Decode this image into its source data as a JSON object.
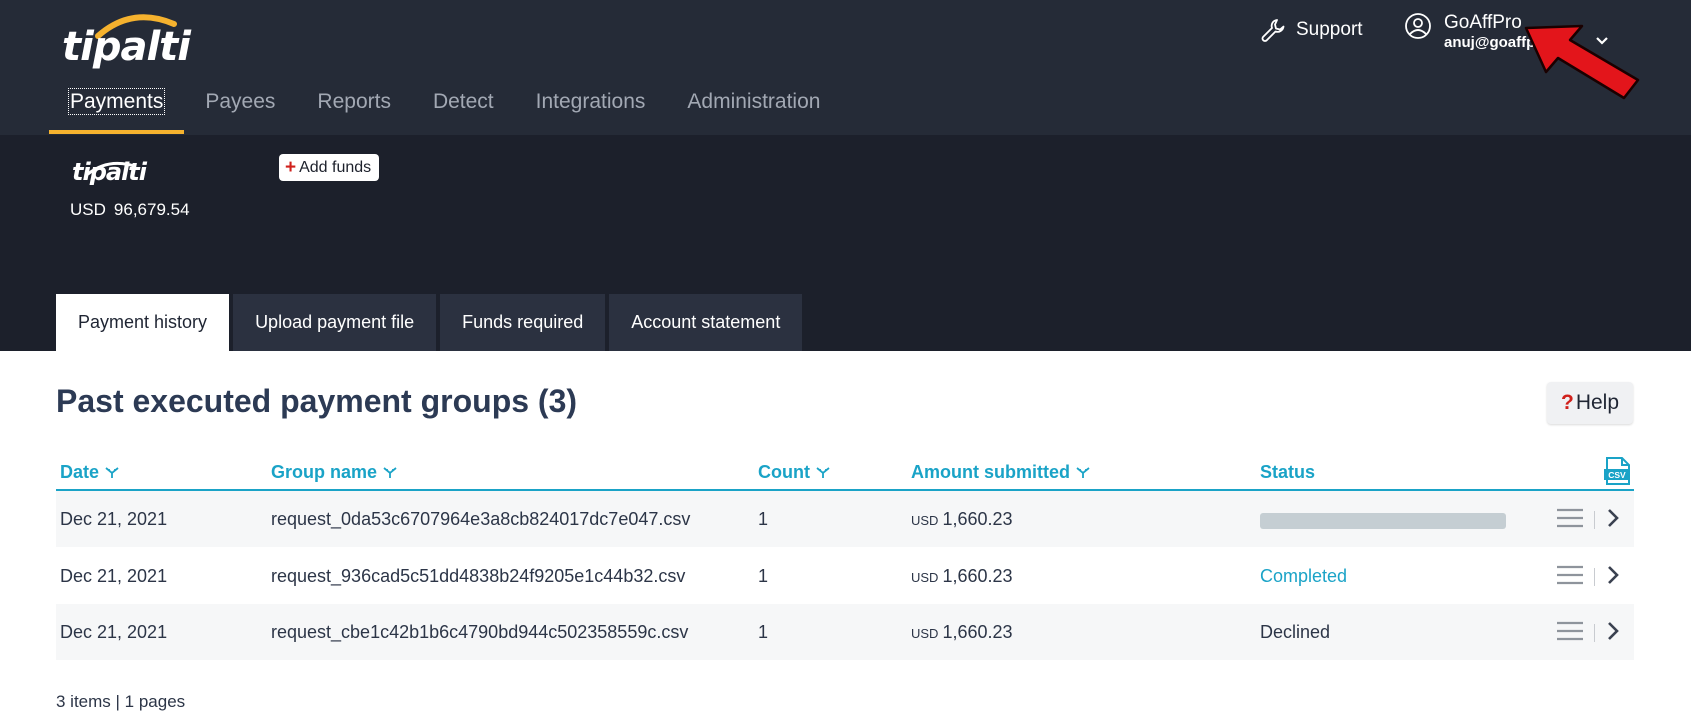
{
  "brand": {
    "logo_text": "tipalti",
    "accent": "#f5b22e"
  },
  "header": {
    "support_label": "Support",
    "support_icon": "wrench-icon",
    "user_name": "GoAffPro",
    "user_email": "anuj@goaffpro",
    "user_icon": "user-circle-icon"
  },
  "nav": {
    "items": [
      {
        "label": "Payments"
      },
      {
        "label": "Payees"
      },
      {
        "label": "Reports"
      },
      {
        "label": "Detect"
      },
      {
        "label": "Integrations"
      },
      {
        "label": "Administration"
      }
    ]
  },
  "funding": {
    "logo_text": "tipalti",
    "currency": "USD",
    "balance": "96,679.54",
    "add_funds_icon": "+",
    "add_funds_label": "Add funds"
  },
  "tabs": [
    {
      "label": "Payment history"
    },
    {
      "label": "Upload payment file"
    },
    {
      "label": "Funds required"
    },
    {
      "label": "Account statement"
    }
  ],
  "main": {
    "title": "Past executed payment groups (3)",
    "help_icon": "?",
    "help_label": "Help"
  },
  "table": {
    "columns": {
      "date": "Date",
      "group_name": "Group name",
      "count": "Count",
      "amount": "Amount submitted",
      "status": "Status"
    },
    "csv_icon_label": "CSV",
    "rows": [
      {
        "date": "Dec 21, 2021",
        "group_name": "request_0da53c6707964e3a8cb824017dc7e047.csv",
        "count": "1",
        "currency": "USD",
        "amount": "1,660.23",
        "status": "",
        "status_progress": 1.0
      },
      {
        "date": "Dec 21, 2021",
        "group_name": "request_936cad5c51dd4838b24f9205e1c44b32.csv",
        "count": "1",
        "currency": "USD",
        "amount": "1,660.23",
        "status": "Completed"
      },
      {
        "date": "Dec 21, 2021",
        "group_name": "request_cbe1c42b1b6c4790bd944c502358559c.csv",
        "count": "1",
        "currency": "USD",
        "amount": "1,660.23",
        "status": "Declined"
      }
    ]
  },
  "pagination": {
    "text": "3 items | 1 pages"
  },
  "colors": {
    "header_bg": "#252b37",
    "band_bg": "#1c202b",
    "link": "#1aa3c7",
    "danger": "#d0211c",
    "annotation_arrow": "#e3151b"
  }
}
